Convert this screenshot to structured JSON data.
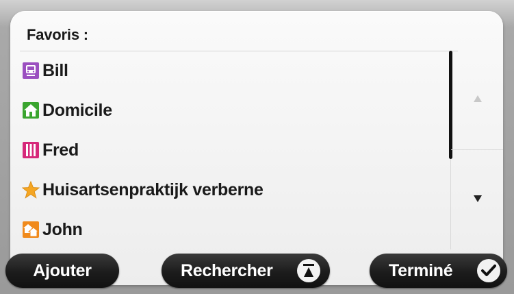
{
  "favorites": {
    "header": "Favoris :",
    "items": [
      {
        "label": "Bill",
        "icon": "train-station-icon",
        "color": "#9b4fc0"
      },
      {
        "label": "Domicile",
        "icon": "home-icon",
        "color": "#3aa52f"
      },
      {
        "label": "Fred",
        "icon": "parking-icon",
        "color": "#d6287a"
      },
      {
        "label": "Huisartsenpraktijk verberne",
        "icon": "star-icon",
        "color": "#f0a020"
      },
      {
        "label": "John",
        "icon": "house-icon",
        "color": "#f08a1c"
      }
    ]
  },
  "scroll": {
    "up_icon": "arrow-up-icon",
    "down_icon": "arrow-down-icon"
  },
  "buttons": {
    "add": "Ajouter",
    "search": "Rechercher",
    "search_icon": "keyboard-toggle-icon",
    "done": "Terminé",
    "done_icon": "checkmark-icon"
  }
}
